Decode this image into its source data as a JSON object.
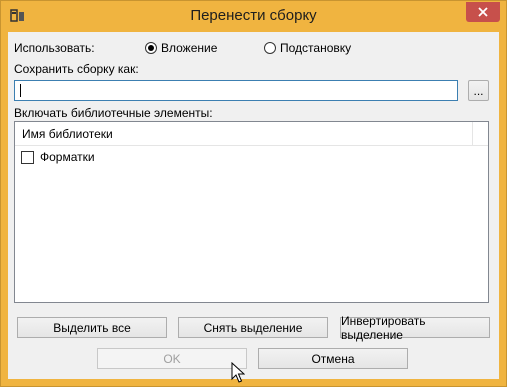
{
  "window": {
    "title": "Перенести сборку"
  },
  "icons": {
    "app": "app-icon",
    "close": "close-icon",
    "cursor": "mouse-cursor-icon"
  },
  "use": {
    "label": "Использовать:",
    "options": [
      {
        "label": "Вложение",
        "selected": true
      },
      {
        "label": "Подстановку",
        "selected": false
      }
    ]
  },
  "save_as": {
    "label": "Сохранить сборку как:",
    "value": "",
    "browse_label": "..."
  },
  "library": {
    "label": "Включать библиотечные элементы:",
    "column_header": "Имя библиотеки",
    "items": [
      {
        "label": "Форматки",
        "checked": false
      }
    ]
  },
  "actions": {
    "select_all": "Выделить все",
    "deselect": "Снять выделение",
    "invert": "Инвертировать выделение"
  },
  "footer": {
    "ok": "OK",
    "cancel": "Отмена"
  },
  "colors": {
    "frame": "#f0b440",
    "close_button": "#c7504b",
    "client": "#f0f0f0"
  }
}
